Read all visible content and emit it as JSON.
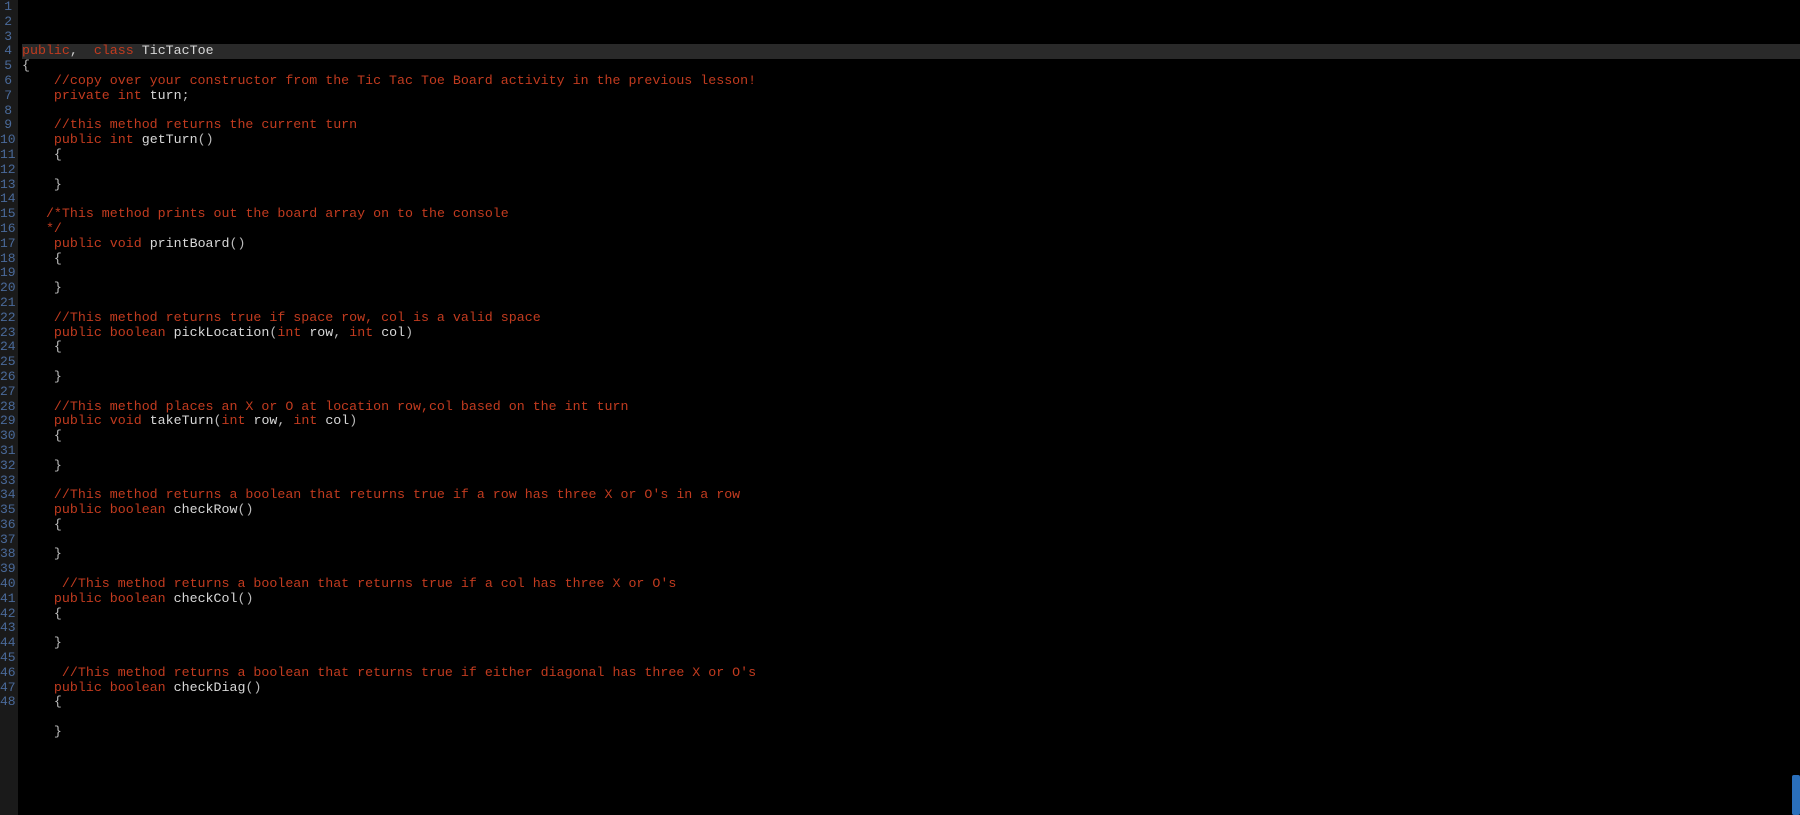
{
  "lines": [
    {
      "n": 1,
      "cls": "hl-first",
      "spans": [
        [
          "kw",
          "public"
        ],
        [
          "",
          ", "
        ],
        [
          "",
          ""
        ],
        [
          "txt",
          " "
        ],
        [
          "kw",
          "class"
        ],
        [
          "txt",
          " "
        ],
        [
          "ident",
          "TicTacToe"
        ]
      ]
    },
    {
      "n": 2,
      "fold": true,
      "spans": [
        [
          "punct",
          "{"
        ]
      ]
    },
    {
      "n": 3,
      "spans": [
        [
          "txt",
          "    "
        ],
        [
          "comment",
          "//copy over your constructor from the Tic Tac Toe Board activity in the previous lesson!"
        ]
      ]
    },
    {
      "n": 4,
      "spans": [
        [
          "txt",
          "    "
        ],
        [
          "kw",
          "private"
        ],
        [
          "txt",
          " "
        ],
        [
          "kw",
          "int"
        ],
        [
          "txt",
          " "
        ],
        [
          "ident",
          "turn"
        ],
        [
          "punct",
          ";"
        ]
      ]
    },
    {
      "n": 5,
      "spans": [
        [
          "txt",
          " "
        ]
      ]
    },
    {
      "n": 6,
      "spans": [
        [
          "txt",
          "    "
        ],
        [
          "comment",
          "//this method returns the current turn"
        ]
      ]
    },
    {
      "n": 7,
      "spans": [
        [
          "txt",
          "    "
        ],
        [
          "kw",
          "public"
        ],
        [
          "txt",
          " "
        ],
        [
          "kw",
          "int"
        ],
        [
          "txt",
          " "
        ],
        [
          "ident",
          "getTurn"
        ],
        [
          "punct",
          "()"
        ]
      ]
    },
    {
      "n": 8,
      "fold": true,
      "spans": [
        [
          "txt",
          "    "
        ],
        [
          "punct",
          "{"
        ]
      ]
    },
    {
      "n": 9,
      "spans": [
        [
          "txt",
          " "
        ]
      ]
    },
    {
      "n": 10,
      "spans": [
        [
          "txt",
          "    "
        ],
        [
          "punct",
          "}"
        ]
      ]
    },
    {
      "n": 11,
      "spans": [
        [
          "txt",
          " "
        ]
      ]
    },
    {
      "n": 12,
      "fold": true,
      "spans": [
        [
          "txt",
          "   "
        ],
        [
          "comment",
          "/*This method prints out the board array on to the console"
        ]
      ]
    },
    {
      "n": 13,
      "spans": [
        [
          "txt",
          "   "
        ],
        [
          "comment",
          "*/"
        ]
      ]
    },
    {
      "n": 14,
      "spans": [
        [
          "txt",
          "    "
        ],
        [
          "kw",
          "public"
        ],
        [
          "txt",
          " "
        ],
        [
          "kw",
          "void"
        ],
        [
          "txt",
          " "
        ],
        [
          "ident",
          "printBoard"
        ],
        [
          "punct",
          "()"
        ]
      ]
    },
    {
      "n": 15,
      "fold": true,
      "spans": [
        [
          "txt",
          "    "
        ],
        [
          "punct",
          "{"
        ]
      ]
    },
    {
      "n": 16,
      "spans": [
        [
          "txt",
          " "
        ]
      ]
    },
    {
      "n": 17,
      "spans": [
        [
          "txt",
          "    "
        ],
        [
          "punct",
          "}"
        ]
      ]
    },
    {
      "n": 18,
      "spans": [
        [
          "txt",
          " "
        ]
      ]
    },
    {
      "n": 19,
      "spans": [
        [
          "txt",
          "    "
        ],
        [
          "comment",
          "//This method returns true if space row, col is a valid space"
        ]
      ]
    },
    {
      "n": 20,
      "spans": [
        [
          "txt",
          "    "
        ],
        [
          "kw",
          "public"
        ],
        [
          "txt",
          " "
        ],
        [
          "kw",
          "boolean"
        ],
        [
          "txt",
          " "
        ],
        [
          "ident",
          "pickLocation"
        ],
        [
          "punct",
          "("
        ],
        [
          "kw",
          "int"
        ],
        [
          "txt",
          " "
        ],
        [
          "ident",
          "row"
        ],
        [
          "punct",
          ", "
        ],
        [
          "kw",
          "int"
        ],
        [
          "txt",
          " "
        ],
        [
          "ident",
          "col"
        ],
        [
          "punct",
          ")"
        ]
      ]
    },
    {
      "n": 21,
      "fold": true,
      "spans": [
        [
          "txt",
          "    "
        ],
        [
          "punct",
          "{"
        ]
      ]
    },
    {
      "n": 22,
      "spans": [
        [
          "txt",
          " "
        ]
      ]
    },
    {
      "n": 23,
      "spans": [
        [
          "txt",
          "    "
        ],
        [
          "punct",
          "}"
        ]
      ]
    },
    {
      "n": 24,
      "spans": [
        [
          "txt",
          " "
        ]
      ]
    },
    {
      "n": 25,
      "spans": [
        [
          "txt",
          "    "
        ],
        [
          "comment",
          "//This method places an X or O at location row,col based on the int turn"
        ]
      ]
    },
    {
      "n": 26,
      "spans": [
        [
          "txt",
          "    "
        ],
        [
          "kw",
          "public"
        ],
        [
          "txt",
          " "
        ],
        [
          "kw",
          "void"
        ],
        [
          "txt",
          " "
        ],
        [
          "ident",
          "takeTurn"
        ],
        [
          "punct",
          "("
        ],
        [
          "kw",
          "int"
        ],
        [
          "txt",
          " "
        ],
        [
          "ident",
          "row"
        ],
        [
          "punct",
          ", "
        ],
        [
          "kw",
          "int"
        ],
        [
          "txt",
          " "
        ],
        [
          "ident",
          "col"
        ],
        [
          "punct",
          ")"
        ]
      ]
    },
    {
      "n": 27,
      "fold": true,
      "spans": [
        [
          "txt",
          "    "
        ],
        [
          "punct",
          "{"
        ]
      ]
    },
    {
      "n": 28,
      "spans": [
        [
          "txt",
          " "
        ]
      ]
    },
    {
      "n": 29,
      "spans": [
        [
          "txt",
          "    "
        ],
        [
          "punct",
          "}"
        ]
      ]
    },
    {
      "n": 30,
      "spans": [
        [
          "txt",
          " "
        ]
      ]
    },
    {
      "n": 31,
      "spans": [
        [
          "txt",
          "    "
        ],
        [
          "comment",
          "//This method returns a boolean that returns true if a row has three X or O's in a row"
        ]
      ]
    },
    {
      "n": 32,
      "spans": [
        [
          "txt",
          "    "
        ],
        [
          "kw",
          "public"
        ],
        [
          "txt",
          " "
        ],
        [
          "kw",
          "boolean"
        ],
        [
          "txt",
          " "
        ],
        [
          "ident",
          "checkRow"
        ],
        [
          "punct",
          "()"
        ]
      ]
    },
    {
      "n": 33,
      "fold": true,
      "spans": [
        [
          "txt",
          "    "
        ],
        [
          "punct",
          "{"
        ]
      ]
    },
    {
      "n": 34,
      "spans": [
        [
          "txt",
          " "
        ]
      ]
    },
    {
      "n": 35,
      "spans": [
        [
          "txt",
          "    "
        ],
        [
          "punct",
          "}"
        ]
      ]
    },
    {
      "n": 36,
      "spans": [
        [
          "txt",
          " "
        ]
      ]
    },
    {
      "n": 37,
      "spans": [
        [
          "txt",
          "     "
        ],
        [
          "comment",
          "//This method returns a boolean that returns true if a col has three X or O's"
        ]
      ]
    },
    {
      "n": 38,
      "spans": [
        [
          "txt",
          "    "
        ],
        [
          "kw",
          "public"
        ],
        [
          "txt",
          " "
        ],
        [
          "kw",
          "boolean"
        ],
        [
          "txt",
          " "
        ],
        [
          "ident",
          "checkCol"
        ],
        [
          "punct",
          "()"
        ]
      ]
    },
    {
      "n": 39,
      "fold": true,
      "spans": [
        [
          "txt",
          "    "
        ],
        [
          "punct",
          "{"
        ]
      ]
    },
    {
      "n": 40,
      "spans": [
        [
          "txt",
          " "
        ]
      ]
    },
    {
      "n": 41,
      "spans": [
        [
          "txt",
          "    "
        ],
        [
          "punct",
          "}"
        ]
      ]
    },
    {
      "n": 42,
      "spans": [
        [
          "txt",
          " "
        ]
      ]
    },
    {
      "n": 43,
      "spans": [
        [
          "txt",
          "     "
        ],
        [
          "comment",
          "//This method returns a boolean that returns true if either diagonal has three X or O's"
        ]
      ]
    },
    {
      "n": 44,
      "spans": [
        [
          "txt",
          "    "
        ],
        [
          "kw",
          "public"
        ],
        [
          "txt",
          " "
        ],
        [
          "kw",
          "boolean"
        ],
        [
          "txt",
          " "
        ],
        [
          "ident",
          "checkDiag"
        ],
        [
          "punct",
          "()"
        ]
      ]
    },
    {
      "n": 45,
      "fold": true,
      "spans": [
        [
          "txt",
          "    "
        ],
        [
          "punct",
          "{"
        ]
      ]
    },
    {
      "n": 46,
      "spans": [
        [
          "txt",
          " "
        ]
      ]
    },
    {
      "n": 47,
      "spans": [
        [
          "txt",
          "    "
        ],
        [
          "punct",
          "}"
        ]
      ]
    },
    {
      "n": 48,
      "spans": [
        [
          "txt",
          " "
        ]
      ]
    }
  ]
}
